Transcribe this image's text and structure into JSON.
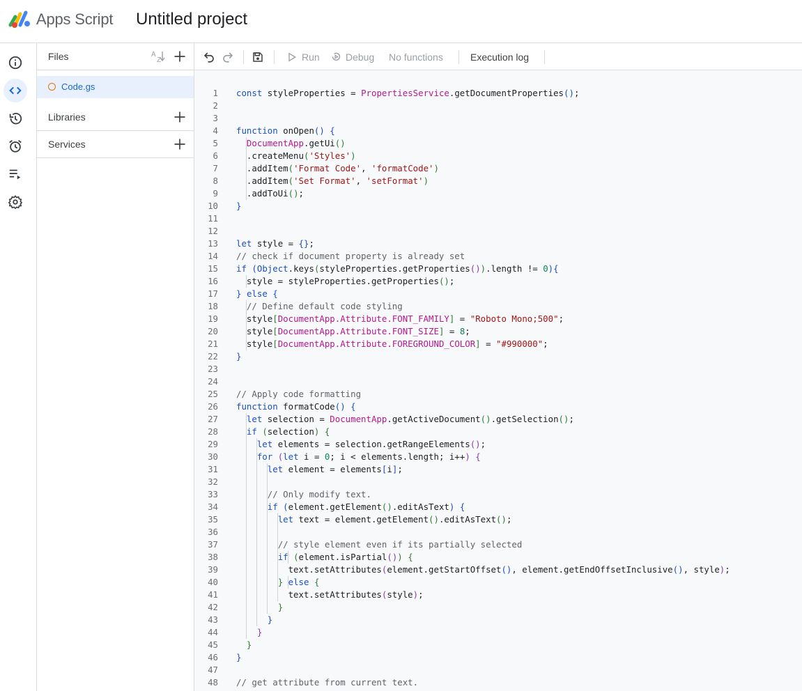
{
  "header": {
    "brand": "Apps Script",
    "project_title": "Untitled project"
  },
  "rail": {
    "items": [
      {
        "name": "overview",
        "icon": "info-icon"
      },
      {
        "name": "editor",
        "icon": "code-icon",
        "active": true
      },
      {
        "name": "versions",
        "icon": "history-icon"
      },
      {
        "name": "triggers",
        "icon": "alarm-icon"
      },
      {
        "name": "executions",
        "icon": "executions-icon"
      },
      {
        "name": "settings",
        "icon": "gear-icon"
      }
    ]
  },
  "files_panel": {
    "files_label": "Files",
    "sort_icon": "sort-az-icon",
    "files": [
      {
        "name": "Code.gs",
        "selected": true
      }
    ],
    "libraries_label": "Libraries",
    "services_label": "Services"
  },
  "toolbar": {
    "run_label": "Run",
    "debug_label": "Debug",
    "function_select": "No functions",
    "execution_log_label": "Execution log"
  },
  "colors": {
    "accent": "#1967d2",
    "selection_bg": "#e8f0fe",
    "file_dot": "#e37400",
    "keyword": "#1a4fc4",
    "class": "#b5178e",
    "string": "#a31515",
    "comment": "#5f6368",
    "number": "#098658"
  },
  "editor": {
    "lines": [
      [
        [
          "kw",
          "const"
        ],
        [
          "t",
          " styleProperties = "
        ],
        [
          "cls",
          "PropertiesService"
        ],
        [
          "t",
          ".getDocumentProperties"
        ],
        [
          "pb",
          "()"
        ],
        [
          "t",
          ";"
        ]
      ],
      [],
      [],
      [
        [
          "kw",
          "function"
        ],
        [
          "t",
          " onOpen"
        ],
        [
          "pb",
          "()"
        ],
        [
          "t",
          " "
        ],
        [
          "pb",
          "{"
        ]
      ],
      [
        [
          "t",
          "  "
        ],
        [
          "cls",
          "DocumentApp"
        ],
        [
          "t",
          ".getUi"
        ],
        [
          "pg",
          "()"
        ]
      ],
      [
        [
          "t",
          "  .createMenu"
        ],
        [
          "pg",
          "("
        ],
        [
          "str",
          "'Styles'"
        ],
        [
          "pg",
          ")"
        ]
      ],
      [
        [
          "t",
          "  .addItem"
        ],
        [
          "pg",
          "("
        ],
        [
          "str",
          "'Format Code'"
        ],
        [
          "t",
          ", "
        ],
        [
          "str",
          "'formatCode'"
        ],
        [
          "pg",
          ")"
        ]
      ],
      [
        [
          "t",
          "  .addItem"
        ],
        [
          "pg",
          "("
        ],
        [
          "str",
          "'Set Format'"
        ],
        [
          "t",
          ", "
        ],
        [
          "str",
          "'setFormat'"
        ],
        [
          "pg",
          ")"
        ]
      ],
      [
        [
          "t",
          "  .addToUi"
        ],
        [
          "pg",
          "()"
        ],
        [
          "t",
          ";"
        ]
      ],
      [
        [
          "pb",
          "}"
        ]
      ],
      [],
      [],
      [
        [
          "kw",
          "let"
        ],
        [
          "t",
          " style = "
        ],
        [
          "pb",
          "{}"
        ],
        [
          "t",
          ";"
        ]
      ],
      [
        [
          "cm",
          "// check if document property is already set"
        ]
      ],
      [
        [
          "kw",
          "if"
        ],
        [
          "t",
          " "
        ],
        [
          "pb",
          "("
        ],
        [
          "kw",
          "Object"
        ],
        [
          "t",
          ".keys"
        ],
        [
          "pg",
          "("
        ],
        [
          "t",
          "styleProperties.getProperties"
        ],
        [
          "pm",
          "()"
        ],
        [
          "pg",
          ")"
        ],
        [
          "t",
          ".length != "
        ],
        [
          "num",
          "0"
        ],
        [
          "pb",
          ")"
        ],
        [
          "pb",
          "{"
        ]
      ],
      [
        [
          "t",
          "  style = styleProperties.getProperties"
        ],
        [
          "pg",
          "()"
        ],
        [
          "t",
          ";"
        ]
      ],
      [
        [
          "pb",
          "}"
        ],
        [
          "t",
          " "
        ],
        [
          "kw",
          "else"
        ],
        [
          "t",
          " "
        ],
        [
          "pb",
          "{"
        ]
      ],
      [
        [
          "t",
          "  "
        ],
        [
          "cm",
          "// Define default code styling"
        ]
      ],
      [
        [
          "t",
          "  style"
        ],
        [
          "pg",
          "["
        ],
        [
          "cls",
          "DocumentApp.Attribute.FONT_FAMILY"
        ],
        [
          "pg",
          "]"
        ],
        [
          "t",
          " = "
        ],
        [
          "str",
          "\"Roboto Mono;500\""
        ],
        [
          "t",
          ";"
        ]
      ],
      [
        [
          "t",
          "  style"
        ],
        [
          "pg",
          "["
        ],
        [
          "cls",
          "DocumentApp.Attribute.FONT_SIZE"
        ],
        [
          "pg",
          "]"
        ],
        [
          "t",
          " = "
        ],
        [
          "num",
          "8"
        ],
        [
          "t",
          ";"
        ]
      ],
      [
        [
          "t",
          "  style"
        ],
        [
          "pg",
          "["
        ],
        [
          "cls",
          "DocumentApp.Attribute.FOREGROUND_COLOR"
        ],
        [
          "pg",
          "]"
        ],
        [
          "t",
          " = "
        ],
        [
          "str",
          "\"#990000\""
        ],
        [
          "t",
          ";"
        ]
      ],
      [
        [
          "pb",
          "}"
        ]
      ],
      [],
      [],
      [
        [
          "cm",
          "// Apply code formatting"
        ]
      ],
      [
        [
          "kw",
          "function"
        ],
        [
          "t",
          " formatCode"
        ],
        [
          "pb",
          "()"
        ],
        [
          "t",
          " "
        ],
        [
          "pb",
          "{"
        ]
      ],
      [
        [
          "t",
          "  "
        ],
        [
          "kw",
          "let"
        ],
        [
          "t",
          " selection = "
        ],
        [
          "cls",
          "DocumentApp"
        ],
        [
          "t",
          ".getActiveDocument"
        ],
        [
          "pg",
          "()"
        ],
        [
          "t",
          ".getSelection"
        ],
        [
          "pg",
          "()"
        ],
        [
          "t",
          ";"
        ]
      ],
      [
        [
          "t",
          "  "
        ],
        [
          "kw",
          "if"
        ],
        [
          "t",
          " "
        ],
        [
          "pg",
          "("
        ],
        [
          "t",
          "selection"
        ],
        [
          "pg",
          ")"
        ],
        [
          "t",
          " "
        ],
        [
          "pg",
          "{"
        ]
      ],
      [
        [
          "t",
          "    "
        ],
        [
          "kw",
          "let"
        ],
        [
          "t",
          " elements = selection.getRangeElements"
        ],
        [
          "pm",
          "()"
        ],
        [
          "t",
          ";"
        ]
      ],
      [
        [
          "t",
          "    "
        ],
        [
          "kw",
          "for"
        ],
        [
          "t",
          " "
        ],
        [
          "pm",
          "("
        ],
        [
          "kw",
          "let"
        ],
        [
          "t",
          " i = "
        ],
        [
          "num",
          "0"
        ],
        [
          "t",
          "; i < elements.length; i++"
        ],
        [
          "pm",
          ")"
        ],
        [
          "t",
          " "
        ],
        [
          "pm",
          "{"
        ]
      ],
      [
        [
          "t",
          "      "
        ],
        [
          "kw",
          "let"
        ],
        [
          "t",
          " element = elements"
        ],
        [
          "pb",
          "["
        ],
        [
          "t",
          "i"
        ],
        [
          "pb",
          "]"
        ],
        [
          "t",
          ";"
        ]
      ],
      [],
      [
        [
          "t",
          "      "
        ],
        [
          "cm",
          "// Only modify text."
        ]
      ],
      [
        [
          "t",
          "      "
        ],
        [
          "kw",
          "if"
        ],
        [
          "t",
          " "
        ],
        [
          "pb",
          "("
        ],
        [
          "t",
          "element.getElement"
        ],
        [
          "pg",
          "()"
        ],
        [
          "t",
          ".editAsText"
        ],
        [
          "pb",
          ")"
        ],
        [
          "t",
          " "
        ],
        [
          "pb",
          "{"
        ]
      ],
      [
        [
          "t",
          "        "
        ],
        [
          "kw",
          "let"
        ],
        [
          "t",
          " text = element.getElement"
        ],
        [
          "pg",
          "()"
        ],
        [
          "t",
          ".editAsText"
        ],
        [
          "pg",
          "()"
        ],
        [
          "t",
          ";"
        ]
      ],
      [],
      [
        [
          "t",
          "        "
        ],
        [
          "cm",
          "// style element even if its partially selected"
        ]
      ],
      [
        [
          "t",
          "        "
        ],
        [
          "kw",
          "if"
        ],
        [
          "t",
          " "
        ],
        [
          "pg",
          "("
        ],
        [
          "t",
          "element.isPartial"
        ],
        [
          "pm",
          "()"
        ],
        [
          "pg",
          ")"
        ],
        [
          "t",
          " "
        ],
        [
          "pg",
          "{"
        ]
      ],
      [
        [
          "t",
          "          text.setAttributes"
        ],
        [
          "pm",
          "("
        ],
        [
          "t",
          "element.getStartOffset"
        ],
        [
          "pb",
          "()"
        ],
        [
          "t",
          ", element.getEndOffsetInclusive"
        ],
        [
          "pb",
          "()"
        ],
        [
          "t",
          ", style"
        ],
        [
          "pm",
          ")"
        ],
        [
          "t",
          ";"
        ]
      ],
      [
        [
          "t",
          "        "
        ],
        [
          "pg",
          "}"
        ],
        [
          "t",
          " "
        ],
        [
          "kw",
          "else"
        ],
        [
          "t",
          " "
        ],
        [
          "pg",
          "{"
        ]
      ],
      [
        [
          "t",
          "          text.setAttributes"
        ],
        [
          "pm",
          "("
        ],
        [
          "t",
          "style"
        ],
        [
          "pm",
          ")"
        ],
        [
          "t",
          ";"
        ]
      ],
      [
        [
          "t",
          "        "
        ],
        [
          "pg",
          "}"
        ]
      ],
      [
        [
          "t",
          "      "
        ],
        [
          "pb",
          "}"
        ]
      ],
      [
        [
          "t",
          "    "
        ],
        [
          "pm",
          "}"
        ]
      ],
      [
        [
          "t",
          "  "
        ],
        [
          "pg",
          "}"
        ]
      ],
      [
        [
          "pb",
          "}"
        ]
      ],
      [],
      [
        [
          "cm",
          "// get attribute from current text."
        ]
      ]
    ],
    "guides": [
      [],
      [],
      [],
      [],
      [
        2
      ],
      [
        2
      ],
      [
        2
      ],
      [
        2
      ],
      [
        2
      ],
      [],
      [],
      [],
      [],
      [],
      [],
      [
        2
      ],
      [],
      [
        2
      ],
      [
        2
      ],
      [
        2
      ],
      [
        2
      ],
      [],
      [],
      [],
      [],
      [],
      [
        2
      ],
      [
        2
      ],
      [
        2,
        4
      ],
      [
        2,
        4
      ],
      [
        2,
        4,
        6
      ],
      [
        2,
        4,
        6
      ],
      [
        2,
        4,
        6
      ],
      [
        2,
        4,
        6
      ],
      [
        2,
        4,
        6,
        8
      ],
      [
        2,
        4,
        6,
        8
      ],
      [
        2,
        4,
        6,
        8
      ],
      [
        2,
        4,
        6,
        8,
        10
      ],
      [
        2,
        4,
        6,
        8
      ],
      [
        2,
        4,
        6,
        8,
        10
      ],
      [
        2,
        4,
        6,
        8
      ],
      [
        2,
        4,
        6
      ],
      [
        2,
        4
      ],
      [
        2
      ],
      [],
      [],
      []
    ]
  }
}
